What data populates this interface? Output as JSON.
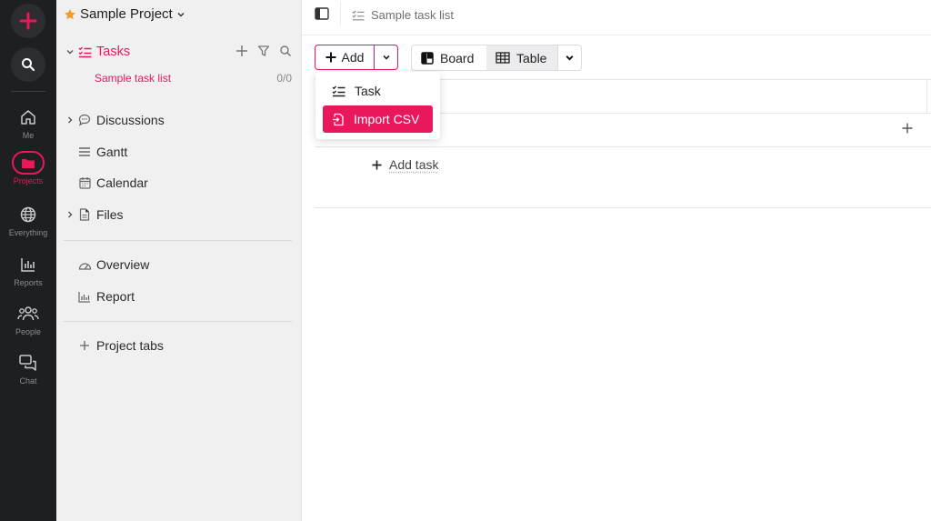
{
  "rail": {
    "items": [
      {
        "label": "Me"
      },
      {
        "label": "Projects"
      },
      {
        "label": "Everything"
      },
      {
        "label": "Reports"
      },
      {
        "label": "People"
      },
      {
        "label": "Chat"
      }
    ],
    "accent": "#e8185a"
  },
  "sidebar": {
    "project_title": "Sample Project",
    "tasks_label": "Tasks",
    "task_list_name": "Sample task list",
    "task_list_count": "0/0",
    "items": [
      {
        "label": "Discussions"
      },
      {
        "label": "Gantt"
      },
      {
        "label": "Calendar"
      },
      {
        "label": "Files"
      },
      {
        "label": "Overview"
      },
      {
        "label": "Report"
      },
      {
        "label": "Project tabs"
      }
    ]
  },
  "topbar": {
    "breadcrumb": "Sample task list"
  },
  "toolbar": {
    "add_label": "Add",
    "board_label": "Board",
    "table_label": "Table"
  },
  "menu": {
    "task_label": "Task",
    "import_label": "Import CSV"
  },
  "table": {
    "add_task_label": "Add task"
  }
}
